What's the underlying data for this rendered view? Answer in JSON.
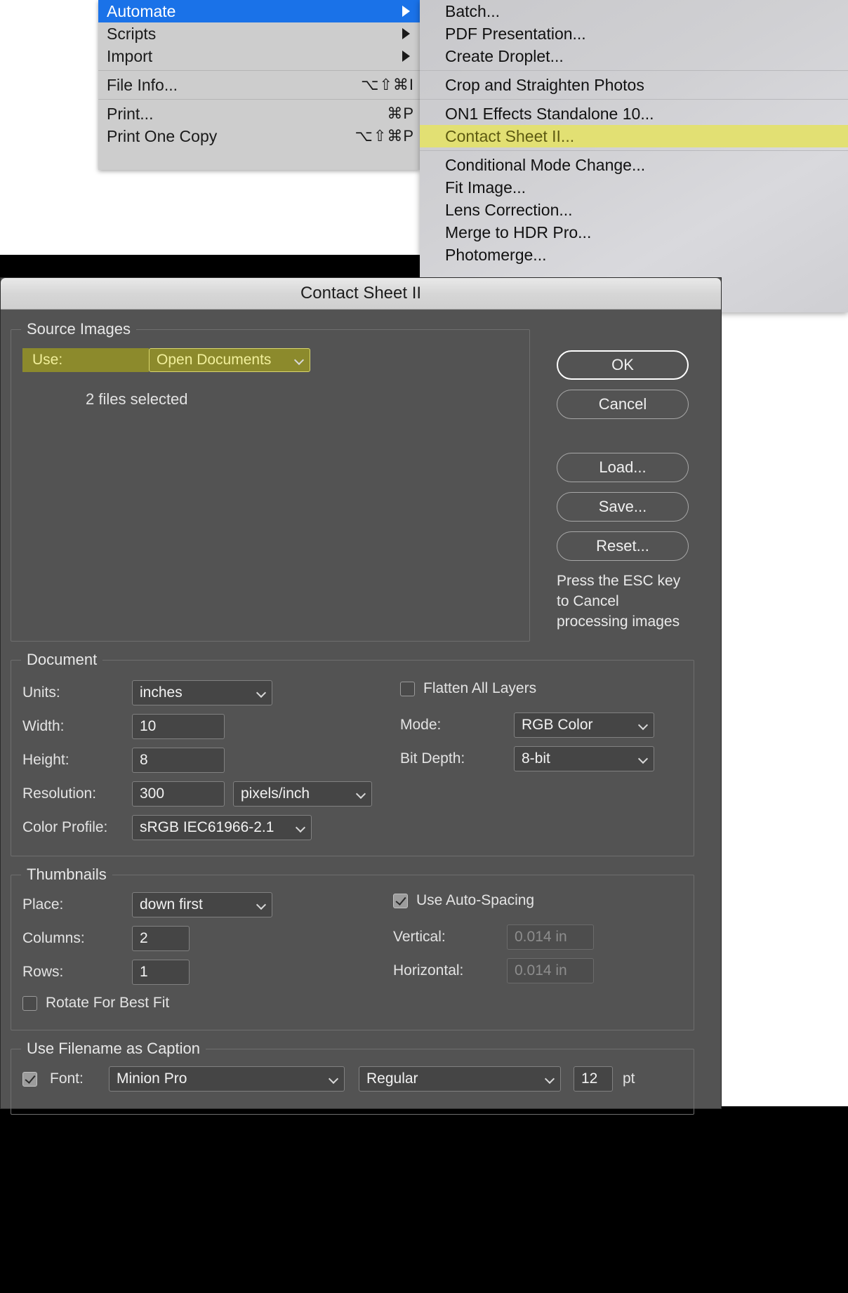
{
  "menu": {
    "items": [
      {
        "label": "Automate",
        "shortcut": "",
        "has_submenu": true,
        "selected": true
      },
      {
        "label": "Scripts",
        "shortcut": "",
        "has_submenu": true,
        "selected": false
      },
      {
        "label": "Import",
        "shortcut": "",
        "has_submenu": true,
        "selected": false
      },
      {
        "label": "File Info...",
        "shortcut": "⌥⇧⌘I",
        "has_submenu": false,
        "selected": false
      },
      {
        "label": "Print...",
        "shortcut": "⌘P",
        "has_submenu": false,
        "selected": false
      },
      {
        "label": "Print One Copy",
        "shortcut": "⌥⇧⌘P",
        "has_submenu": false,
        "selected": false
      }
    ]
  },
  "submenu": {
    "items": [
      {
        "label": "Batch...",
        "highlighted": false
      },
      {
        "label": "PDF Presentation...",
        "highlighted": false
      },
      {
        "label": "Create Droplet...",
        "highlighted": false
      },
      {
        "label": "Crop and Straighten Photos",
        "highlighted": false
      },
      {
        "label": "ON1 Effects Standalone 10...",
        "highlighted": false
      },
      {
        "label": "Contact Sheet II...",
        "highlighted": true
      },
      {
        "label": "Conditional Mode Change...",
        "highlighted": false
      },
      {
        "label": "Fit Image...",
        "highlighted": false
      },
      {
        "label": "Lens Correction...",
        "highlighted": false
      },
      {
        "label": "Merge to HDR Pro...",
        "highlighted": false
      },
      {
        "label": "Photomerge...",
        "highlighted": false
      }
    ],
    "highlight_color": "#e2e073"
  },
  "dialog": {
    "title": "Contact Sheet II",
    "source_images": {
      "legend": "Source Images",
      "use_label": "Use:",
      "use_value": "Open Documents",
      "files_selected": "2 files selected",
      "highlight_bg": "#8c8a2c",
      "highlight_fg": "#f1ef9a"
    },
    "buttons": {
      "ok": "OK",
      "cancel": "Cancel",
      "load": "Load...",
      "save": "Save...",
      "reset": "Reset..."
    },
    "esc_note": "Press the ESC key to Cancel processing images",
    "document": {
      "legend": "Document",
      "units_label": "Units:",
      "units_value": "inches",
      "width_label": "Width:",
      "width_value": "10",
      "height_label": "Height:",
      "height_value": "8",
      "resolution_label": "Resolution:",
      "resolution_value": "300",
      "resolution_units": "pixels/inch",
      "color_profile_label": "Color Profile:",
      "color_profile_value": "sRGB IEC61966-2.1",
      "flatten_label": "Flatten All Layers",
      "flatten_checked": false,
      "mode_label": "Mode:",
      "mode_value": "RGB Color",
      "bit_depth_label": "Bit Depth:",
      "bit_depth_value": "8-bit"
    },
    "thumbnails": {
      "legend": "Thumbnails",
      "place_label": "Place:",
      "place_value": "down first",
      "columns_label": "Columns:",
      "columns_value": "2",
      "rows_label": "Rows:",
      "rows_value": "1",
      "rotate_label": "Rotate For Best Fit",
      "rotate_checked": false,
      "auto_spacing_label": "Use Auto-Spacing",
      "auto_spacing_checked": true,
      "vertical_label": "Vertical:",
      "vertical_value": "0.014 in",
      "horizontal_label": "Horizontal:",
      "horizontal_value": "0.014 in"
    },
    "caption": {
      "legend": "Use Filename as Caption",
      "enabled": true,
      "font_label": "Font:",
      "font_family": "Minion Pro",
      "font_style": "Regular",
      "font_size": "12",
      "font_size_unit": "pt"
    }
  }
}
